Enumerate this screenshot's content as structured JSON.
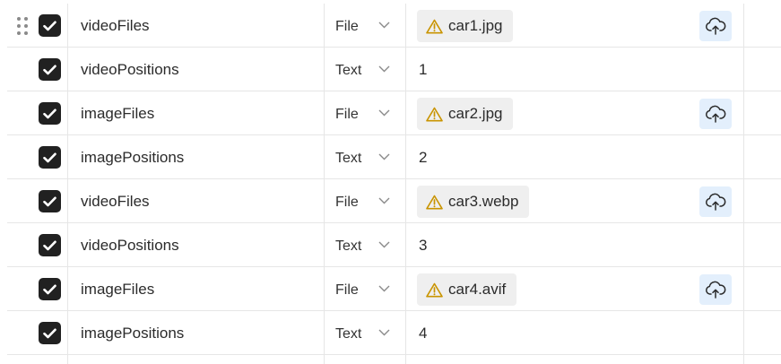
{
  "colors": {
    "checkbox": "#212121",
    "warning": "#c99400",
    "upload_bg": "#e3effc",
    "chip_bg": "#efefef"
  },
  "rows": [
    {
      "key": "videoFiles",
      "type": "File",
      "kind": "file",
      "value": "car1.jpg",
      "has_drag_handle": true
    },
    {
      "key": "videoPositions",
      "type": "Text",
      "kind": "text",
      "value": "1"
    },
    {
      "key": "imageFiles",
      "type": "File",
      "kind": "file",
      "value": "car2.jpg"
    },
    {
      "key": "imagePositions",
      "type": "Text",
      "kind": "text",
      "value": "2"
    },
    {
      "key": "videoFiles",
      "type": "File",
      "kind": "file",
      "value": "car3.webp"
    },
    {
      "key": "videoPositions",
      "type": "Text",
      "kind": "text",
      "value": "3"
    },
    {
      "key": "imageFiles",
      "type": "File",
      "kind": "file",
      "value": "car4.avif"
    },
    {
      "key": "imagePositions",
      "type": "Text",
      "kind": "text",
      "value": "4"
    }
  ],
  "icons": {
    "drag": "drag-handle-icon",
    "check": "checkmark-icon",
    "chevron": "chevron-down-icon",
    "warning": "warning-icon",
    "upload": "cloud-upload-icon"
  }
}
